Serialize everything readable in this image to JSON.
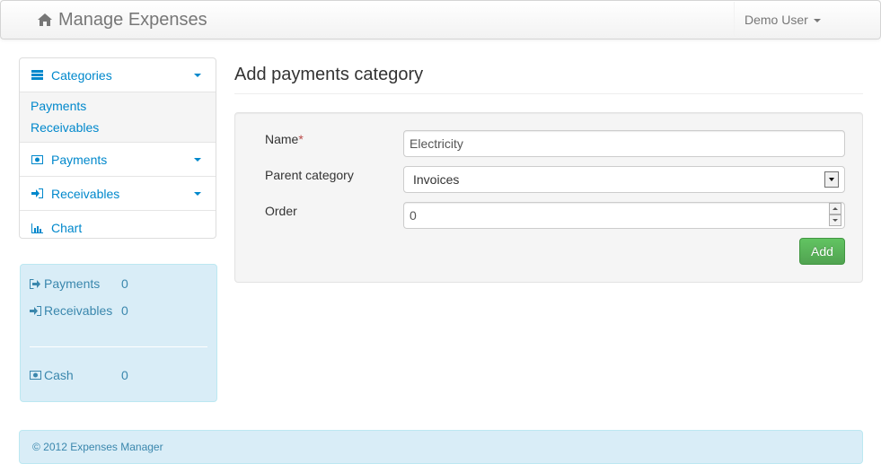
{
  "navbar": {
    "brand": "Manage Expenses",
    "brand_icon": "home-icon",
    "user": "Demo User"
  },
  "sidebar": {
    "sections": [
      {
        "label": "Categories",
        "icon": "list-icon",
        "items": [
          "Payments",
          "Receivables"
        ]
      },
      {
        "label": "Payments",
        "icon": "money-icon"
      },
      {
        "label": "Receivables",
        "icon": "sign-in-icon"
      },
      {
        "label": "Chart",
        "icon": "bar-chart-icon"
      }
    ]
  },
  "stats": {
    "payments_label": "Payments",
    "payments_value": "0",
    "receivables_label": "Receivables",
    "receivables_value": "0",
    "cash_label": "Cash",
    "cash_value": "0"
  },
  "main": {
    "title": "Add payments category",
    "form": {
      "name_label": "Name",
      "name_required": "*",
      "name_value": "Electricity",
      "parent_label": "Parent category",
      "parent_value": "Invoices",
      "order_label": "Order",
      "order_value": "0",
      "submit_label": "Add"
    }
  },
  "footer": {
    "text": "© 2012 Expenses Manager"
  },
  "colors": {
    "link": "#0088cc",
    "info_bg": "#d9edf7",
    "info_text": "#3a87ad",
    "success": "#5bb75b",
    "required": "#b94a48"
  }
}
